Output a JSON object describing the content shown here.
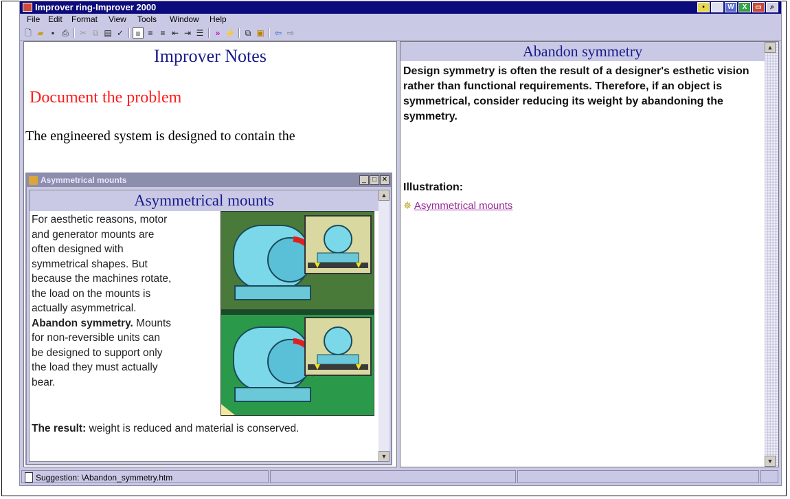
{
  "window": {
    "title": "Improver ring-Improver 2000"
  },
  "menu": [
    "File",
    "Edit",
    "Format",
    "View",
    "Tools",
    "Window",
    "Help"
  ],
  "notes": {
    "title": "Improver Notes",
    "heading": "Document the problem",
    "body": "The engineered system is designed to contain the"
  },
  "subwindow": {
    "titlebar": "Asymmetrical mounts",
    "header": "Asymmetrical mounts",
    "para_lines": [
      "For aesthetic reasons, motor",
      "and generator mounts are",
      "often designed with",
      "symmetrical shapes. But",
      "because the machines rotate,",
      "the load on the mounts is",
      "actually asymmetrical."
    ],
    "bold_lead": "Abandon symmetry.",
    "bold_tail": " Mounts",
    "para2_lines": [
      "for non-reversible units can",
      "be designed to support only",
      "the load they must actually",
      "bear."
    ],
    "result_lead": "The result:",
    "result_text": " weight is reduced and material is conserved."
  },
  "suggestion": {
    "header": "Abandon symmetry",
    "body": "Design symmetry is often the result of a designer's esthetic vision rather than functional requirements. Therefore, if an object is symmetrical, consider reducing its weight by abandoning the symmetry.",
    "illustration_label": "Illustration:",
    "link": "Asymmetrical mounts"
  },
  "status": {
    "text": "Suggestion: \\Abandon_symmetry.htm"
  },
  "colors": {
    "title_bg": "#0b0b7c",
    "panel_bg": "#c9c9e6",
    "heading_red": "#ff1a1a",
    "heading_blue": "#1a1a8c",
    "link": "#9a2a9a"
  }
}
